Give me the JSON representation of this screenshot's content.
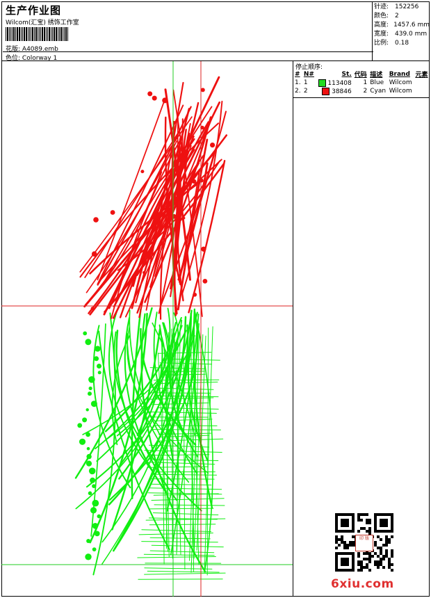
{
  "header": {
    "title": "生产作业图",
    "company": "Wilcom(汇宝) 绣饰工作室",
    "design_label": "花版:",
    "design_value": "A4089.emb",
    "colorway_label": "色位:",
    "colorway_value": "Colorway 1"
  },
  "stats": {
    "stitches_label": "针迹:",
    "stitches_value": "152256",
    "colors_label": "颜色:",
    "colors_value": "2",
    "height_label": "高度:",
    "height_value": "1457.6 mm",
    "width_label": "宽度:",
    "width_value": "439.0 mm",
    "scale_label": "比例:",
    "scale_value": "0.18"
  },
  "stop_sequence": {
    "title": "停止顺序:",
    "columns": [
      "#",
      "N#",
      "St.",
      "代码",
      "描述",
      "Brand",
      "元素"
    ],
    "rows": [
      {
        "index": "1.",
        "n": "1",
        "swatch": "#22dd22",
        "stitches": "113408",
        "code": "1",
        "desc": "Blue",
        "brand": "Wilcom",
        "element": ""
      },
      {
        "index": "2.",
        "n": "2",
        "swatch": "#ee1111",
        "stitches": "38846",
        "code": "2",
        "desc": "Cyan",
        "brand": "Wilcom",
        "element": ""
      }
    ]
  },
  "colors": {
    "thread_green": "#11ee11",
    "thread_red": "#ee1111",
    "guide_green": "#22cc22",
    "guide_red": "#dd2222"
  },
  "watermark": "6xiu.com",
  "qr_stamp": "印 版"
}
